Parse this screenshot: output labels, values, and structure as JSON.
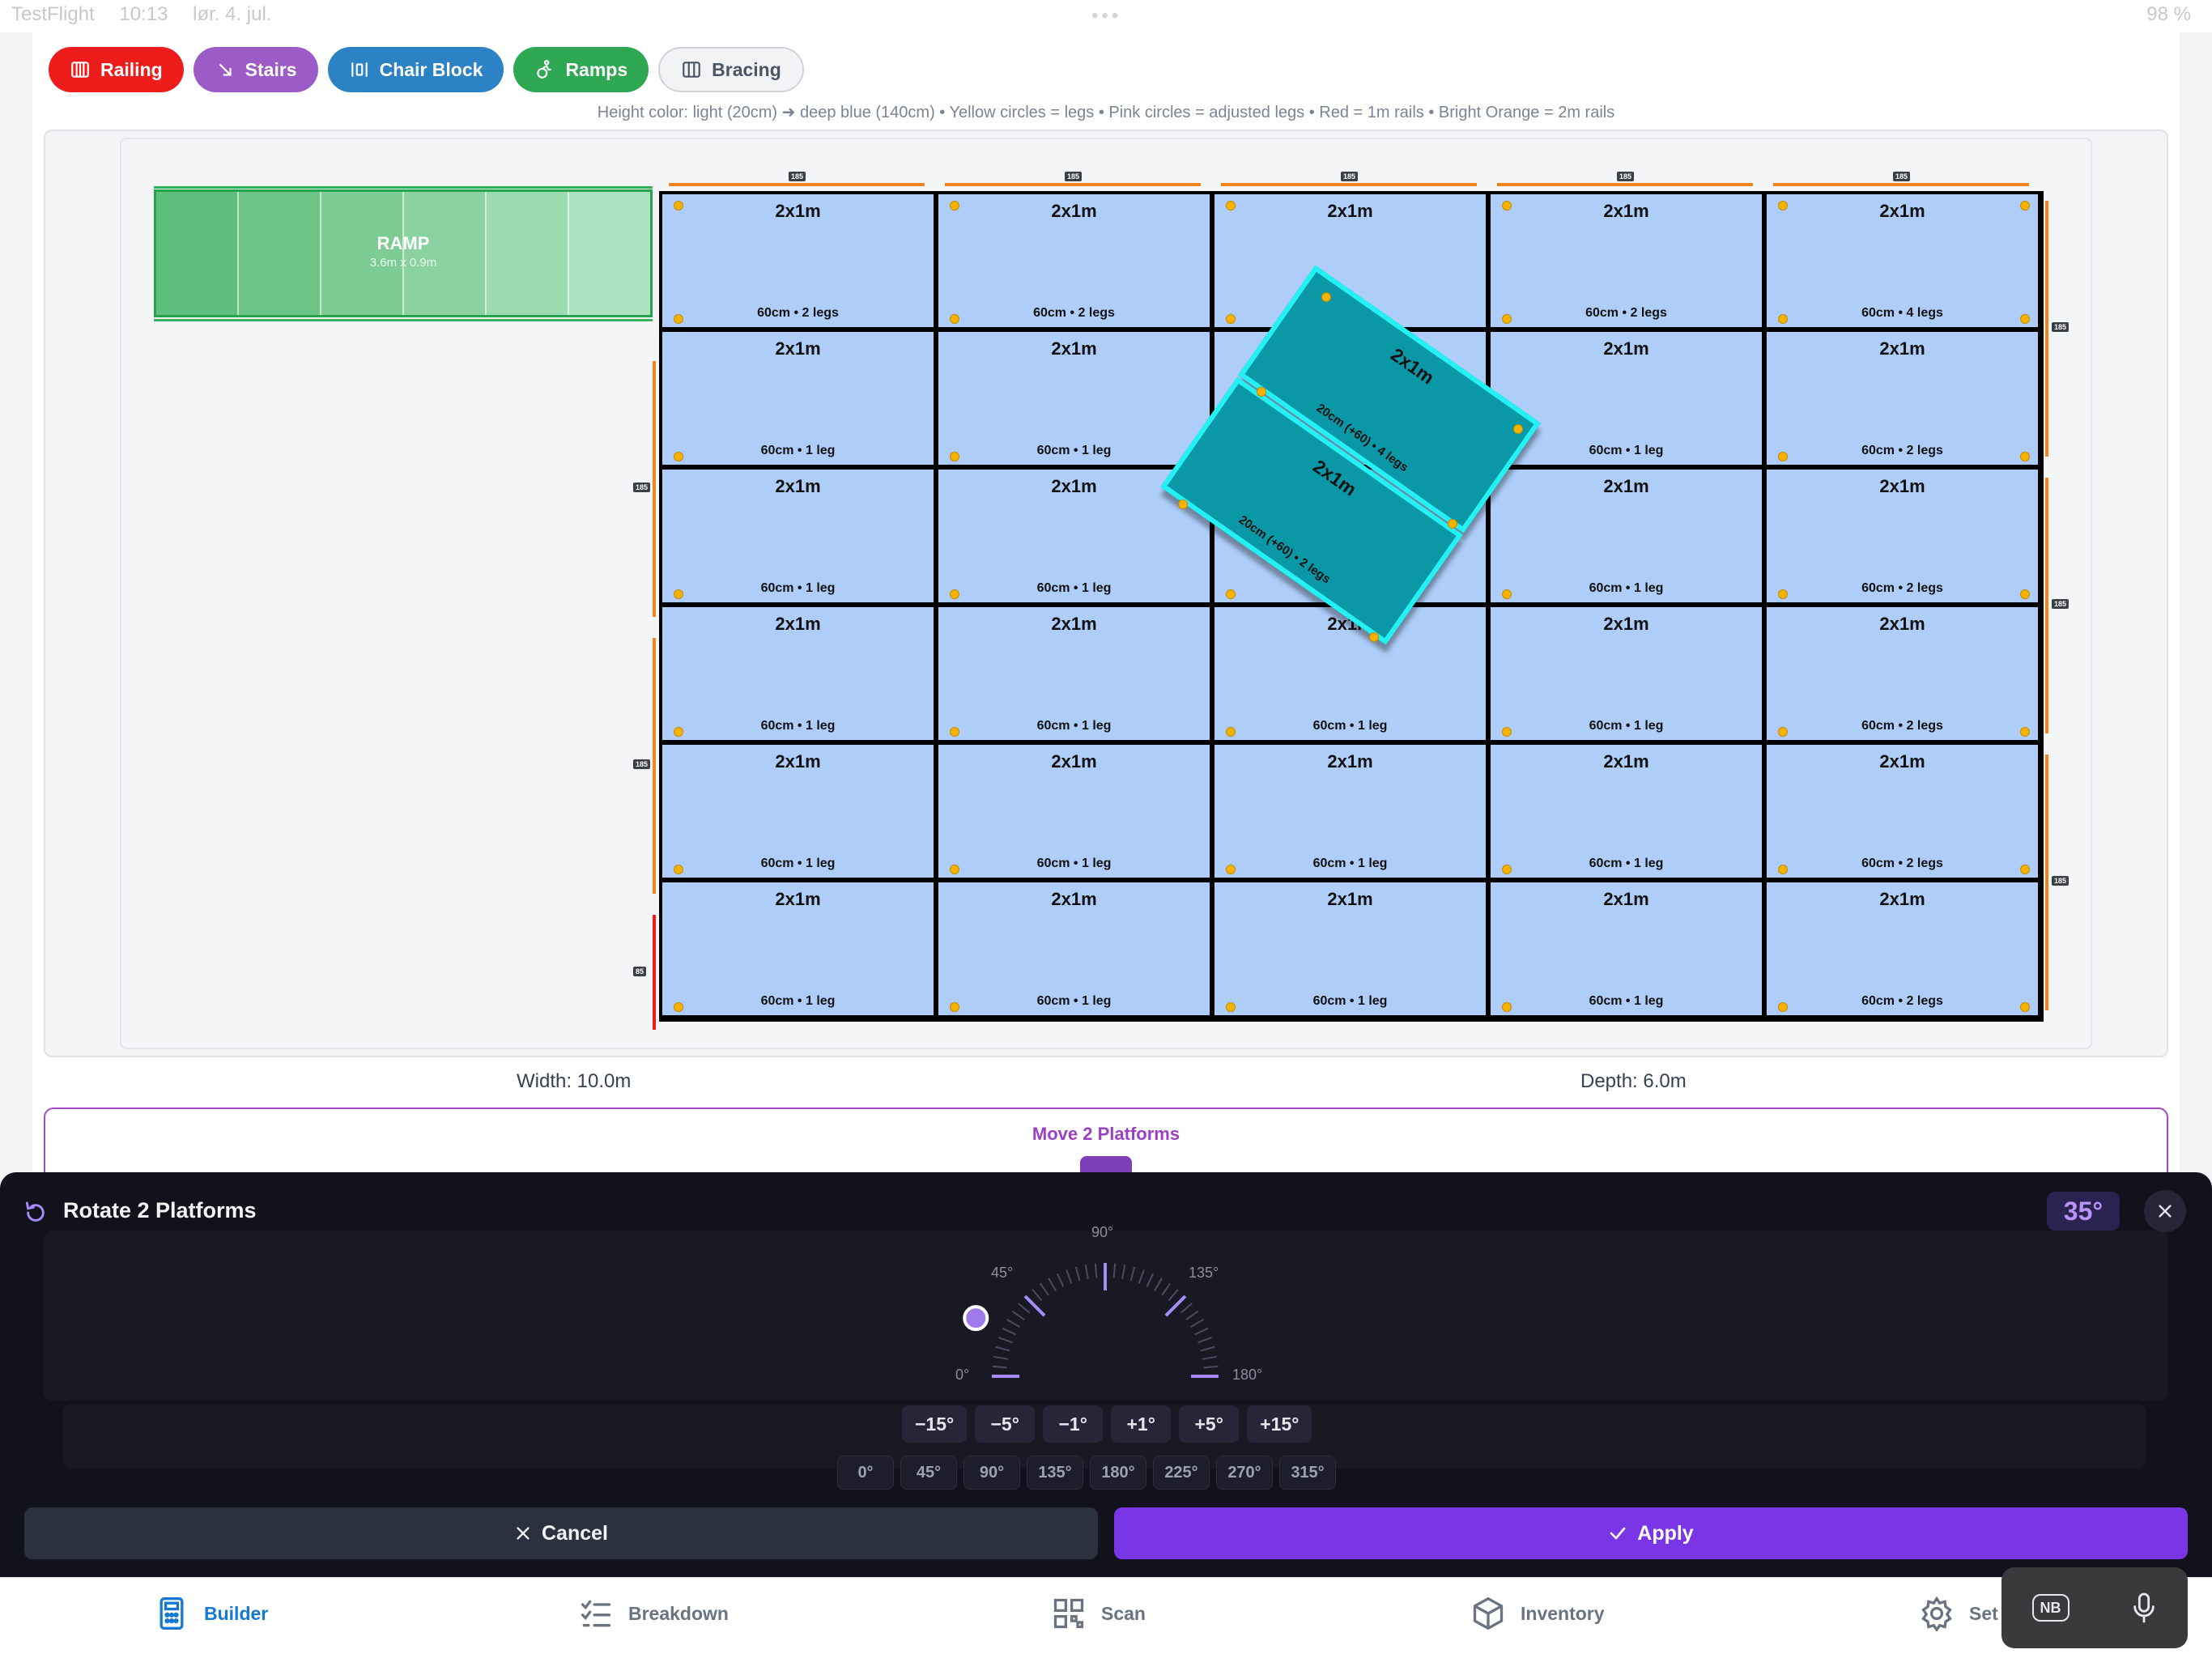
{
  "status": {
    "app": "TestFlight",
    "time": "10:13",
    "date": "lør. 4. jul.",
    "battery": "98 %"
  },
  "toolbar": {
    "buttons": [
      {
        "label": "Railing",
        "icon": "railing-icon",
        "color": "#ef1c1c"
      },
      {
        "label": "Stairs",
        "icon": "stairs-icon",
        "color": "#9b5cc8"
      },
      {
        "label": "Chair Block",
        "icon": "chair-block-icon",
        "color": "#2b82c4"
      },
      {
        "label": "Ramps",
        "icon": "ramps-icon",
        "color": "#2ea852"
      },
      {
        "label": "Bracing",
        "icon": "bracing-icon",
        "color": "#f2f3f5"
      }
    ]
  },
  "legend": "Height color: light (20cm) ➜ deep blue (140cm) • Yellow circles = legs • Pink circles = adjusted legs • Red = 1m rails • Bright Orange = 2m rails",
  "ramp": {
    "title": "RAMP",
    "size": "3.6m x 0.9m"
  },
  "platforms": {
    "title": "2x1m",
    "rows": [
      [
        "60cm • 2 legs",
        "60cm • 2 legs",
        "",
        "60cm • 2 legs",
        "60cm • 4 legs"
      ],
      [
        "60cm • 1 leg",
        "60cm • 1 leg",
        "",
        "60cm • 1 leg",
        "60cm • 2 legs"
      ],
      [
        "60cm • 1 leg",
        "60cm • 1 leg",
        "",
        "60cm • 1 leg",
        "60cm • 2 legs"
      ],
      [
        "60cm • 1 leg",
        "60cm • 1 leg",
        "60cm • 1 leg",
        "60cm • 1 leg",
        "60cm • 2 legs"
      ],
      [
        "60cm • 1 leg",
        "60cm • 1 leg",
        "60cm • 1 leg",
        "60cm • 1 leg",
        "60cm • 2 legs"
      ],
      [
        "60cm • 1 leg",
        "60cm • 1 leg",
        "60cm • 1 leg",
        "60cm • 1 leg",
        "60cm • 2 legs"
      ]
    ]
  },
  "rotated": [
    {
      "title": "2x1m",
      "sub": "20cm (+60) • 4 legs"
    },
    {
      "title": "2x1m",
      "sub": "20cm (+60) • 2 legs"
    }
  ],
  "rail_tags": {
    "two_m": "185",
    "one_m": "85"
  },
  "dimensions": {
    "width": "Width: 10.0m",
    "depth": "Depth: 6.0m"
  },
  "move_panel": {
    "title": "Move 2 Platforms"
  },
  "rotate_sheet": {
    "title": "Rotate 2 Platforms",
    "angle": "35°",
    "angle_value": 35,
    "dial_labels": {
      "a0": "0°",
      "a45": "45°",
      "a90": "90°",
      "a135": "135°",
      "a180": "180°"
    },
    "step_buttons": [
      "−15°",
      "−5°",
      "−1°",
      "+1°",
      "+5°",
      "+15°"
    ],
    "quick_buttons": [
      "0°",
      "45°",
      "90°",
      "135°",
      "180°",
      "225°",
      "270°",
      "315°"
    ],
    "cancel": "Cancel",
    "apply": "Apply"
  },
  "tabs": [
    {
      "label": "Builder",
      "icon": "calculator-icon",
      "active": true
    },
    {
      "label": "Breakdown",
      "icon": "checklist-icon",
      "active": false
    },
    {
      "label": "Scan",
      "icon": "qr-code-icon",
      "active": false
    },
    {
      "label": "Inventory",
      "icon": "box-icon",
      "active": false
    },
    {
      "label": "Set",
      "icon": "gear-icon",
      "active": false
    }
  ],
  "voice": {
    "keyboard": "NB"
  },
  "colors": {
    "accent": "#7a36e6",
    "platform": "#aecdf9",
    "selected": "#0a98a6",
    "selected_border": "#23f1f4",
    "leg": "#f5b301",
    "rail_2m": "#f0861b",
    "rail_1m": "#ef1c1c"
  }
}
